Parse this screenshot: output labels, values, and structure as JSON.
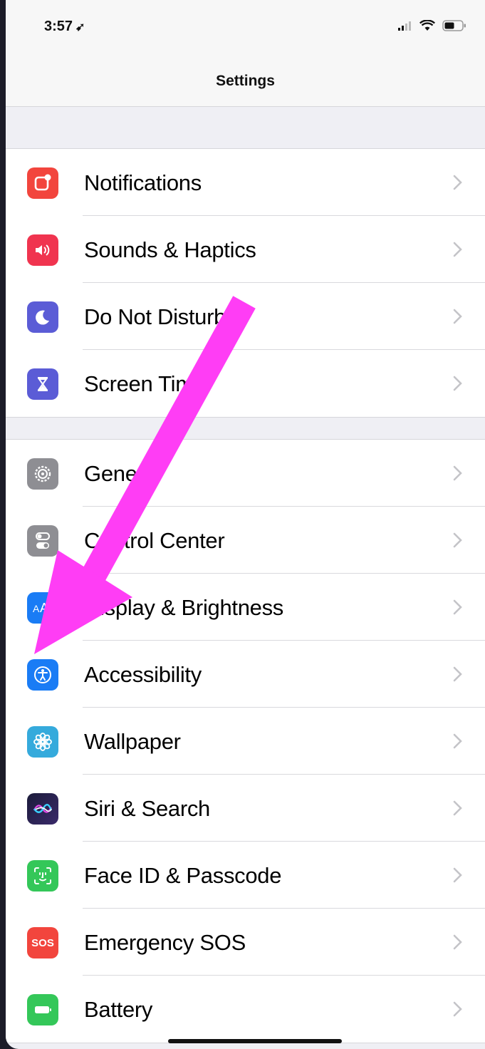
{
  "status_bar": {
    "time": "3:57",
    "location_glyph": "➹",
    "icons": [
      "signal-icon",
      "wifi-icon",
      "battery-icon"
    ]
  },
  "nav": {
    "title": "Settings"
  },
  "groups": [
    {
      "items": [
        {
          "label": "Notifications",
          "icon": "notifications-icon",
          "color": "#f2453d"
        },
        {
          "label": "Sounds & Haptics",
          "icon": "sounds-icon",
          "color": "#f0344f"
        },
        {
          "label": "Do Not Disturb",
          "icon": "moon-icon",
          "color": "#5b5cd6"
        },
        {
          "label": "Screen Time",
          "icon": "hourglass-icon",
          "color": "#5b5cd6"
        }
      ]
    },
    {
      "items": [
        {
          "label": "General",
          "icon": "gear-icon",
          "color": "#8e8e93"
        },
        {
          "label": "Control Center",
          "icon": "toggles-icon",
          "color": "#8e8e93"
        },
        {
          "label": "Display & Brightness",
          "icon": "display-icon",
          "color": "#1a7cf5"
        },
        {
          "label": "Accessibility",
          "icon": "accessibility-icon",
          "color": "#1a7cf5"
        },
        {
          "label": "Wallpaper",
          "icon": "wallpaper-icon",
          "color": "#35aadc"
        },
        {
          "label": "Siri & Search",
          "icon": "siri-icon",
          "color": "#2a2a4a"
        },
        {
          "label": "Face ID & Passcode",
          "icon": "faceid-icon",
          "color": "#34c759"
        },
        {
          "label": "Emergency SOS",
          "icon": "sos-icon",
          "color": "#f2453d",
          "glyph": "SOS"
        },
        {
          "label": "Battery",
          "icon": "battery-setting-icon",
          "color": "#34c759"
        }
      ]
    }
  ],
  "annotation": {
    "arrow_color": "#ff3df5"
  }
}
